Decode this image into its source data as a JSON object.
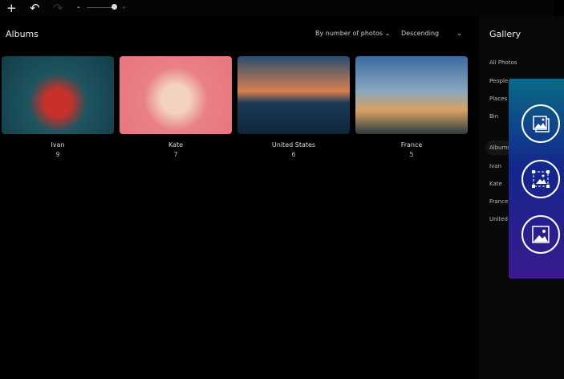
{
  "toolbar": {
    "add": "+",
    "undo": "↶",
    "redo": "↷",
    "zoom_out": "-",
    "zoom_in": "+",
    "zoom_level": 1.0
  },
  "main": {
    "title": "Albums",
    "sort_by": "By number of photos",
    "order": "Descending",
    "albums": [
      {
        "name": "Ivan",
        "count": "9"
      },
      {
        "name": "Kate",
        "count": "7"
      },
      {
        "name": "United States",
        "count": "6"
      },
      {
        "name": "France",
        "count": "5"
      }
    ]
  },
  "sidebar": {
    "title": "Gallery",
    "items": [
      "All Photos",
      "People",
      "Places",
      "Bin"
    ],
    "albums_header": "Albums",
    "albums": [
      "Ivan",
      "Kate",
      "France",
      "United States"
    ]
  },
  "panel": {
    "icons": [
      "photo-stack-icon",
      "photo-crop-icon",
      "photo-icon"
    ]
  }
}
